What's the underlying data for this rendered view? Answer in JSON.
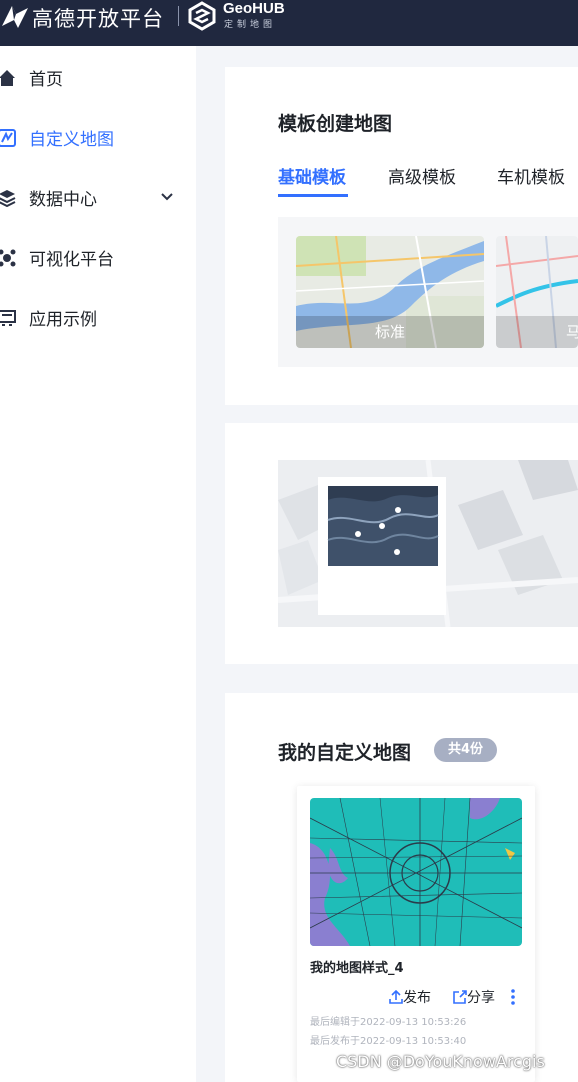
{
  "header": {
    "brand": "高德开放平台",
    "geohub_title": "GeoHUB",
    "geohub_subtitle": "定制地图"
  },
  "sidebar": {
    "items": [
      {
        "label": "首页",
        "icon": "home-icon",
        "active": false
      },
      {
        "label": "自定义地图",
        "icon": "custom-map-icon",
        "active": true
      },
      {
        "label": "数据中心",
        "icon": "layers-icon",
        "active": false,
        "expandable": true
      },
      {
        "label": "可视化平台",
        "icon": "visual-platform-icon",
        "active": false
      },
      {
        "label": "应用示例",
        "icon": "app-example-icon",
        "active": false
      }
    ]
  },
  "templates": {
    "title": "模板创建地图",
    "tabs": [
      {
        "label": "基础模板",
        "active": true
      },
      {
        "label": "高级模板",
        "active": false
      },
      {
        "label": "车机模板",
        "active": false
      }
    ],
    "items": [
      {
        "label": "标准"
      },
      {
        "label": "马"
      }
    ]
  },
  "my_maps": {
    "title": "我的自定义地图",
    "count_badge": "共4份",
    "cards": [
      {
        "name": "我的地图样式_4",
        "publish_label": "发布",
        "share_label": "分享",
        "edited": "最后编辑于2022-09-13 10:53:26",
        "published": "最后发布于2022-09-13 10:53:40"
      }
    ]
  },
  "watermark": "CSDN @DoYouKnowArcgis",
  "colors": {
    "accent": "#3370ff",
    "topbar": "#20283f",
    "badge": "#a7afc3"
  }
}
